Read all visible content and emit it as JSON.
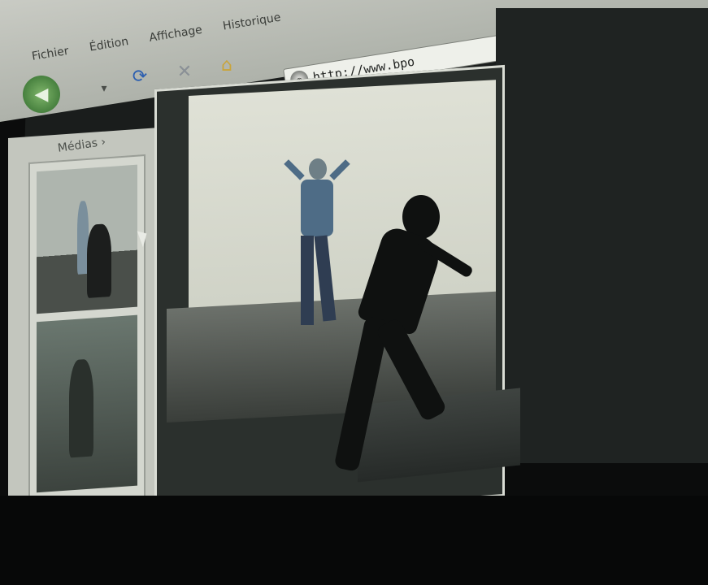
{
  "menu": {
    "items": [
      "Fichier",
      "Édition",
      "Affichage",
      "Historique"
    ]
  },
  "toolbar": {
    "back_icon": "back-arrow-icon",
    "forward_dropdown": "▾",
    "reload_icon": "reload-icon",
    "stop_icon": "stop-icon",
    "home_icon": "home-icon"
  },
  "address_bar": {
    "url": "http://www.bpo"
  },
  "page": {
    "breadcrumb": "Médias ›"
  },
  "colors": {
    "chrome": "#aeb2aa",
    "screen": "#1a1d1c",
    "video_bg": "#dfe1d6"
  }
}
